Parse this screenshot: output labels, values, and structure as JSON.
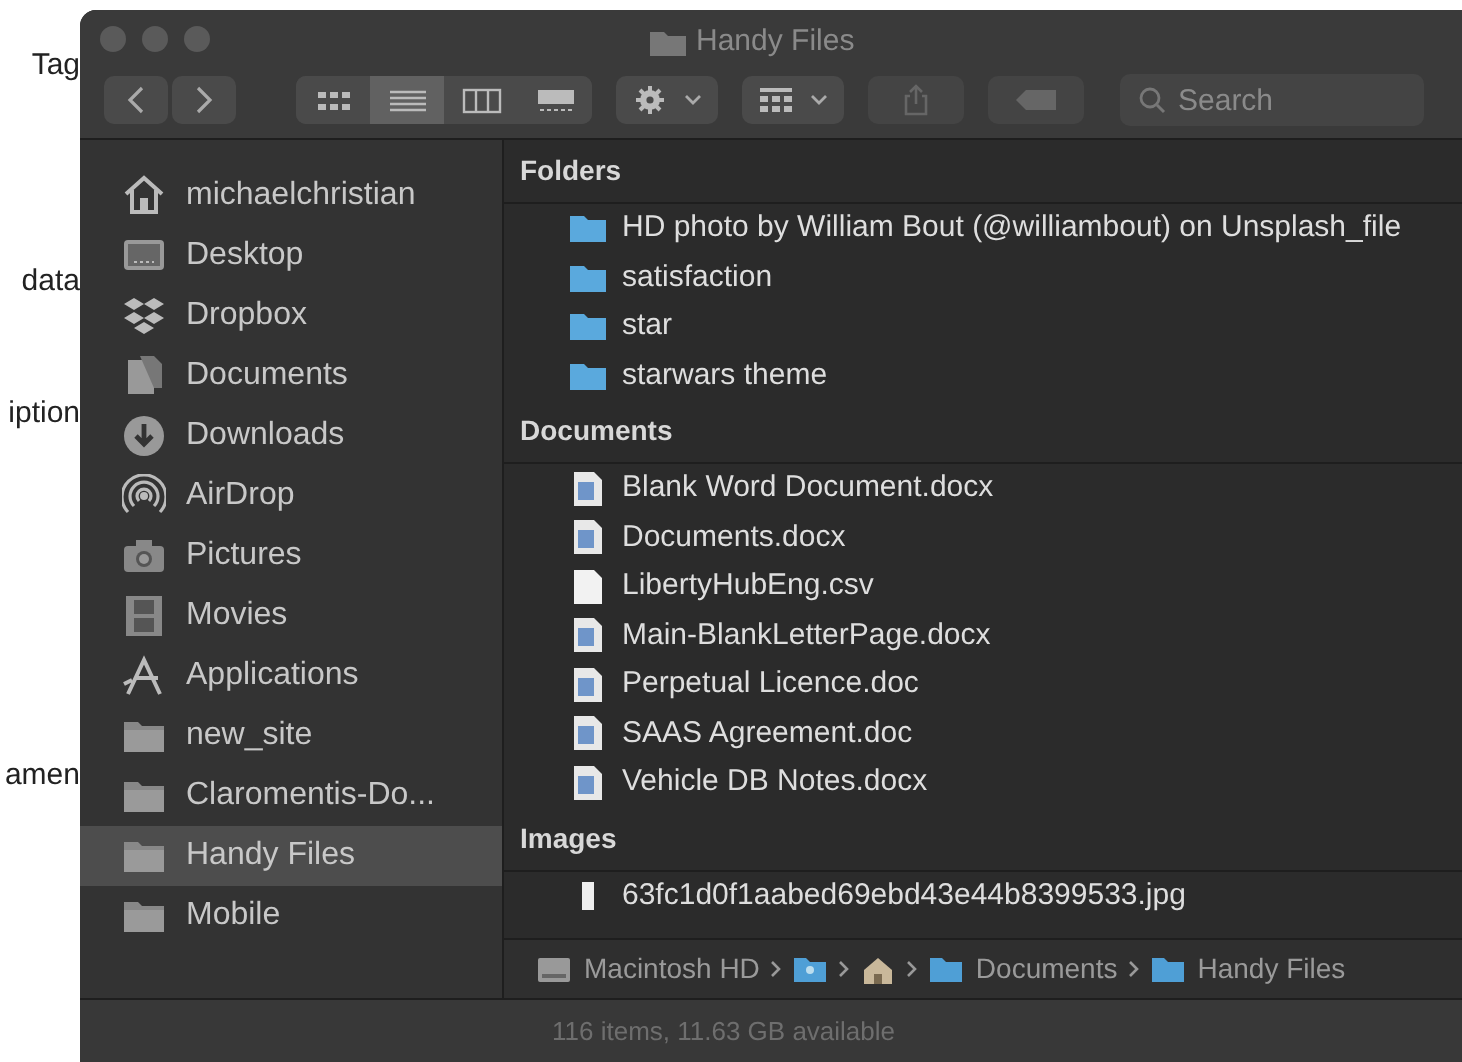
{
  "background_texts": [
    "Tag",
    "data",
    "iption",
    "amen"
  ],
  "window": {
    "title": "Handy Files"
  },
  "toolbar": {
    "views": [
      {
        "kind": "icons",
        "selected": false
      },
      {
        "kind": "list",
        "selected": true
      },
      {
        "kind": "columns",
        "selected": false
      },
      {
        "kind": "gallery",
        "selected": false
      }
    ],
    "search": {
      "placeholder": "Search"
    }
  },
  "sidebar": {
    "items": [
      {
        "label": "michaelchristian",
        "kind": "home",
        "selected": false
      },
      {
        "label": "Desktop",
        "kind": "desktop",
        "selected": false
      },
      {
        "label": "Dropbox",
        "kind": "dropbox",
        "selected": false
      },
      {
        "label": "Documents",
        "kind": "documents",
        "selected": false
      },
      {
        "label": "Downloads",
        "kind": "downloads",
        "selected": false
      },
      {
        "label": "AirDrop",
        "kind": "airdrop",
        "selected": false
      },
      {
        "label": "Pictures",
        "kind": "pictures",
        "selected": false
      },
      {
        "label": "Movies",
        "kind": "movies",
        "selected": false
      },
      {
        "label": "Applications",
        "kind": "applications",
        "selected": false
      },
      {
        "label": "new_site",
        "kind": "folder",
        "selected": false
      },
      {
        "label": "Claromentis-Do...",
        "kind": "folder",
        "selected": false
      },
      {
        "label": "Handy Files",
        "kind": "folder",
        "selected": true
      },
      {
        "label": "Mobile",
        "kind": "folder",
        "selected": false
      }
    ]
  },
  "groups": [
    {
      "title": "Folders",
      "items": [
        {
          "name": "HD photo by William Bout (@williambout) on Unsplash_file",
          "kind": "folder"
        },
        {
          "name": "satisfaction",
          "kind": "folder"
        },
        {
          "name": "star",
          "kind": "folder"
        },
        {
          "name": "starwars theme",
          "kind": "folder"
        }
      ]
    },
    {
      "title": "Documents",
      "items": [
        {
          "name": "Blank Word Document.docx",
          "kind": "word"
        },
        {
          "name": "Documents.docx",
          "kind": "word"
        },
        {
          "name": "LibertyHubEng.csv",
          "kind": "plain"
        },
        {
          "name": "Main-BlankLetterPage.docx",
          "kind": "word"
        },
        {
          "name": "Perpetual Licence.doc",
          "kind": "word"
        },
        {
          "name": "SAAS Agreement.doc",
          "kind": "word"
        },
        {
          "name": "Vehicle DB Notes.docx",
          "kind": "word"
        }
      ]
    },
    {
      "title": "Images",
      "items": [
        {
          "name": "63fc1d0f1aabed69ebd43e44b8399533.jpg",
          "kind": "image"
        }
      ]
    }
  ],
  "path_bar": [
    {
      "label": "Macintosh HD",
      "kind": "disk"
    },
    {
      "kind": "user"
    },
    {
      "kind": "home"
    },
    {
      "label": "Documents",
      "kind": "folder"
    },
    {
      "label": "Handy Files",
      "kind": "folder"
    }
  ],
  "status_bar": "116 items, 11.63 GB available"
}
